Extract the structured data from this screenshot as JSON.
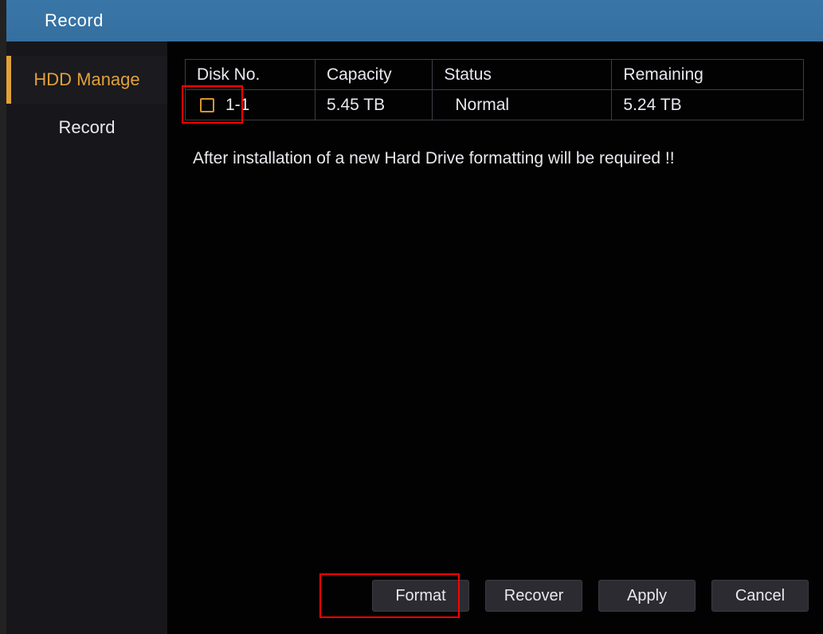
{
  "header": {
    "title": "Record"
  },
  "sidebar": {
    "items": [
      {
        "label": "HDD Manage",
        "active": true
      },
      {
        "label": "Record",
        "active": false
      }
    ]
  },
  "table": {
    "columns": {
      "disk_no": "Disk No.",
      "capacity": "Capacity",
      "status": "Status",
      "remaining": "Remaining"
    },
    "rows": [
      {
        "disk_no": "1-1",
        "capacity": "5.45 TB",
        "status": "Normal",
        "remaining": "5.24 TB"
      }
    ]
  },
  "warning_text": "After installation of a new Hard Drive formatting will be required !!",
  "buttons": {
    "format": "Format",
    "recover": "Recover",
    "apply": "Apply",
    "cancel": "Cancel"
  }
}
